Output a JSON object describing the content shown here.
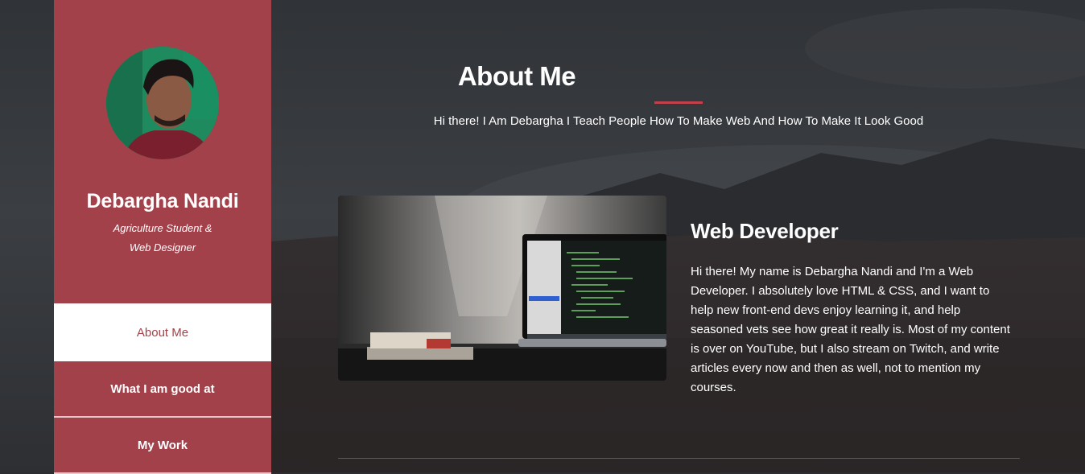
{
  "sidebar": {
    "name": "Debargha Nandi",
    "tagline_line1": "Agriculture Student &",
    "tagline_line2": "Web Designer",
    "nav": [
      {
        "label": "About Me",
        "active": true
      },
      {
        "label": "What I am good at",
        "active": false
      },
      {
        "label": "My Work",
        "active": false
      }
    ]
  },
  "main": {
    "title": "About Me",
    "subtitle": "Hi there! I Am Debargha I Teach People How To Make Web And How To Make It Look Good",
    "role_title": "Web Developer",
    "role_description": "Hi there! My name is Debargha Nandi and I'm a Web Developer. I absolutely love HTML & CSS, and I want to help new front-end devs enjoy learning it, and help seasoned vets see how great it really is. Most of my content is over on YouTube, but I also stream on Twitch, and write articles every now and then as well, not to mention my courses."
  },
  "colors": {
    "accent": "#a3414b",
    "heading_underline": "#c2404c",
    "background": "#2e3134",
    "text": "#ffffff"
  }
}
